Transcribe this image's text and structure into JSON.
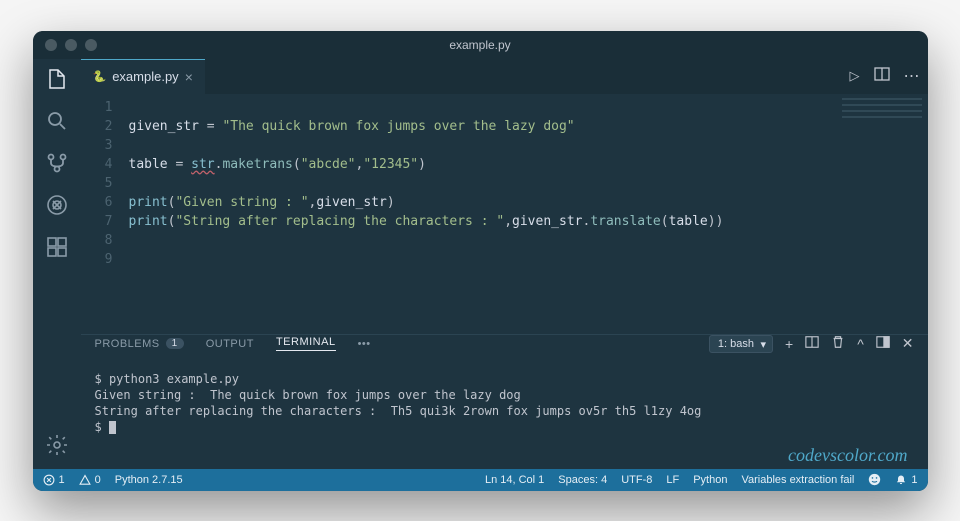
{
  "window": {
    "title": "example.py"
  },
  "tabs": {
    "file": {
      "name": "example.py",
      "icon": "python"
    },
    "actions": {
      "run": "▷",
      "split": "▯▯",
      "more": "⋯"
    }
  },
  "editor": {
    "lines": [
      "1",
      "2",
      "3",
      "4",
      "5",
      "6",
      "7",
      "8",
      "9"
    ],
    "l2": {
      "var": "given_str",
      "eq": " = ",
      "str": "\"The quick brown fox jumps over the lazy dog\""
    },
    "l4": {
      "var": "table",
      "eq": " = ",
      "obj": "str",
      "dot": ".",
      "fn": "maketrans",
      "open": "(",
      "arg1": "\"abcde\"",
      "comma": ",",
      "arg2": "\"12345\"",
      "close": ")"
    },
    "l6": {
      "fn": "print",
      "open": "(",
      "str": "\"Given string : \"",
      "comma": ",",
      "arg": "given_str",
      "close": ")"
    },
    "l7": {
      "fn": "print",
      "open": "(",
      "str": "\"String after replacing the characters : \"",
      "comma": ",",
      "obj": "given_str",
      "dot": ".",
      "method": "translate",
      "open2": "(",
      "arg": "table",
      "close2": ")",
      "close": ")"
    }
  },
  "panel": {
    "tabs": {
      "problems": "PROBLEMS",
      "problems_badge": "1",
      "output": "OUTPUT",
      "terminal": "TERMINAL",
      "more": "•••"
    },
    "term_select": "1: bash"
  },
  "terminal": {
    "l1": "$ python3 example.py",
    "l2": "Given string :  The quick brown fox jumps over the lazy dog",
    "l3": "String after replacing the characters :  Th5 qui3k 2rown fox jumps ov5r th5 l1zy 4og",
    "l4": "$ "
  },
  "watermark": "codevscolor.com",
  "status": {
    "errors": "1",
    "warnings": "0",
    "python": "Python 2.7.15",
    "pos": "Ln 14, Col 1",
    "spaces": "Spaces: 4",
    "encoding": "UTF-8",
    "eol": "LF",
    "lang": "Python",
    "extra": "Variables extraction fail",
    "bell": "1"
  }
}
